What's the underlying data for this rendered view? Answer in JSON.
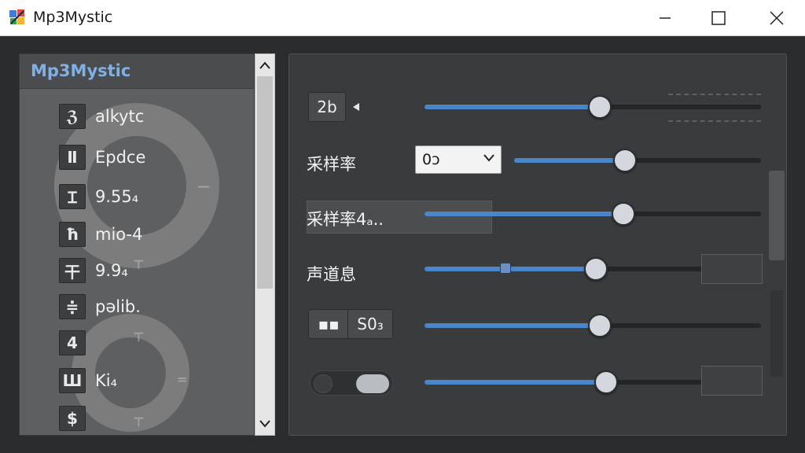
{
  "window": {
    "title": "Mp3Mystic",
    "controls": {
      "minimize": "minimize",
      "maximize": "maximize",
      "close": "close"
    }
  },
  "sidebar": {
    "title": "Mp3Mystic",
    "items": [
      {
        "badge": "ℨ",
        "label": "alkytc"
      },
      {
        "badge": "Ⅱ",
        "label": "Epdce"
      },
      {
        "badge": "Ɪ",
        "label": "9.55₄"
      },
      {
        "badge": "ħ",
        "label": "mio-4"
      },
      {
        "badge": "干",
        "label": "9.9₄"
      },
      {
        "badge": "≑",
        "label": "pəlib."
      },
      {
        "badge": "4",
        "label": ""
      },
      {
        "badge": "Ш",
        "label": "Ki₄"
      },
      {
        "badge": "$",
        "label": ""
      }
    ]
  },
  "controls": {
    "row1": {
      "button": "2b",
      "slider": 0.52
    },
    "row2": {
      "label": "采样率",
      "dropdown_value": "0ɔ",
      "slider": 0.45
    },
    "row3": {
      "label": "采样率4ₐ..",
      "slider": 0.59
    },
    "row4": {
      "label": "声道息",
      "slider": 0.51,
      "marker": 0.24
    },
    "row5": {
      "button_left": "▪▪",
      "button_right": "S0₃",
      "slider": 0.52
    },
    "row6": {
      "toggle_on": true,
      "slider": 0.54
    }
  },
  "colors": {
    "accent": "#4a86c8",
    "title": "#7fb0e6"
  }
}
